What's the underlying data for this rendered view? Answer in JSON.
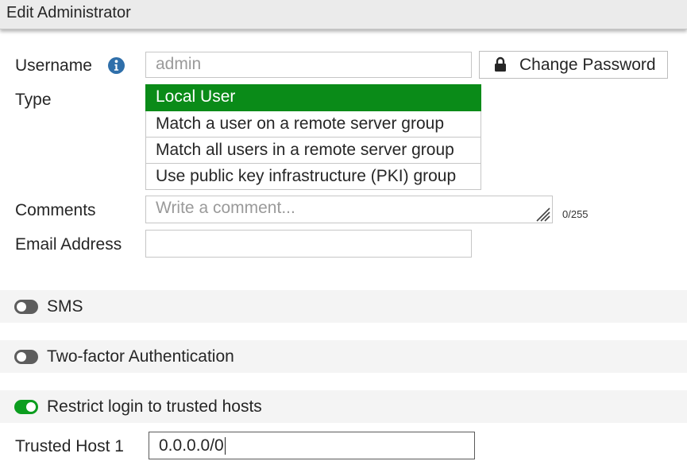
{
  "window": {
    "title": "Edit Administrator"
  },
  "form": {
    "username": {
      "label": "Username",
      "value": "admin",
      "info_icon": "info-circle-icon"
    },
    "change_password": {
      "label": "Change Password",
      "icon": "lock-icon"
    },
    "type": {
      "label": "Type",
      "options": [
        "Local User",
        "Match a user on a remote server group",
        "Match all users in a remote server group",
        "Use public key infrastructure (PKI) group"
      ],
      "selected": "Local User"
    },
    "comments": {
      "label": "Comments",
      "placeholder": "Write a comment...",
      "counter": "0/255"
    },
    "email": {
      "label": "Email Address",
      "value": ""
    }
  },
  "sections": {
    "sms": {
      "label": "SMS",
      "enabled": false
    },
    "two_factor": {
      "label": "Two-factor Authentication",
      "enabled": false
    },
    "restrict_login": {
      "label": "Restrict login to trusted hosts",
      "enabled": true
    }
  },
  "trusted_host_1": {
    "label": "Trusted Host 1",
    "value": "0.0.0.0/0"
  },
  "colors": {
    "selected_option": "#0a8b18",
    "toggle_on": "#0c9d1f",
    "toggle_off": "#5d5d5d",
    "info_icon": "#2f6faa"
  }
}
